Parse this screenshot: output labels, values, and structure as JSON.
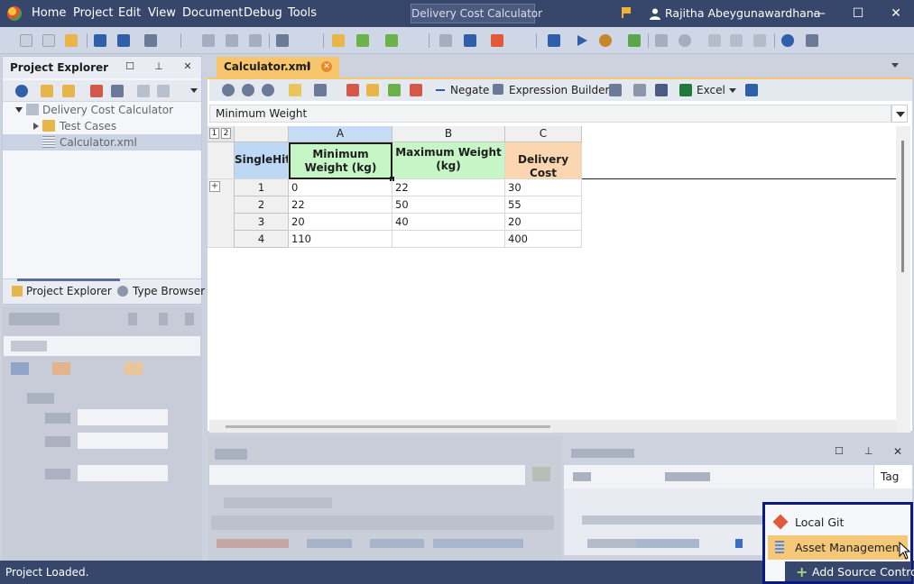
{
  "app": {
    "menu": [
      "Home",
      "Project",
      "Edit",
      "View",
      "Document",
      "Debug",
      "Tools"
    ],
    "window_title": "Delivery Cost Calculator",
    "user_name": "Rajitha Abeygunawardhana",
    "accent": "#37476c"
  },
  "explorer": {
    "title": "Project Explorer",
    "tree": {
      "root": "Delivery Cost Calculator",
      "folder": "Test Cases",
      "file": "Calculator.xml"
    },
    "tabs": [
      "Project Explorer",
      "Type Browser"
    ]
  },
  "document": {
    "tab_label": "Calculator.xml",
    "toolbar": {
      "negate": "Negate",
      "expression_builder": "Expression Builder",
      "excel": "Excel"
    },
    "formula_value": "Minimum Weight",
    "grid": {
      "level_buttons": [
        "1",
        "2"
      ],
      "hit_policy": "SingleHit",
      "columns": [
        {
          "letter": "A",
          "header": "Minimum Weight (kg)",
          "color": "#c6f5c6"
        },
        {
          "letter": "B",
          "header": "Maximum Weight (kg)",
          "color": "#c6f5c6"
        },
        {
          "letter": "C",
          "header": "Delivery Cost",
          "color": "#fcd6b0"
        }
      ],
      "rows": [
        {
          "n": "1",
          "a": "0",
          "b": "22",
          "c": "30"
        },
        {
          "n": "2",
          "a": "22",
          "b": "50",
          "c": "55"
        },
        {
          "n": "3",
          "a": "20",
          "b": "40",
          "c": "20"
        },
        {
          "n": "4",
          "a": "110",
          "b": "",
          "c": "400"
        }
      ]
    }
  },
  "bottom_panel": {
    "tag_column": "Tag"
  },
  "popup": {
    "items": [
      "Local Git",
      "Asset Management"
    ]
  },
  "status": {
    "text": "Project Loaded.",
    "add_source_control": "Add Source Control"
  }
}
